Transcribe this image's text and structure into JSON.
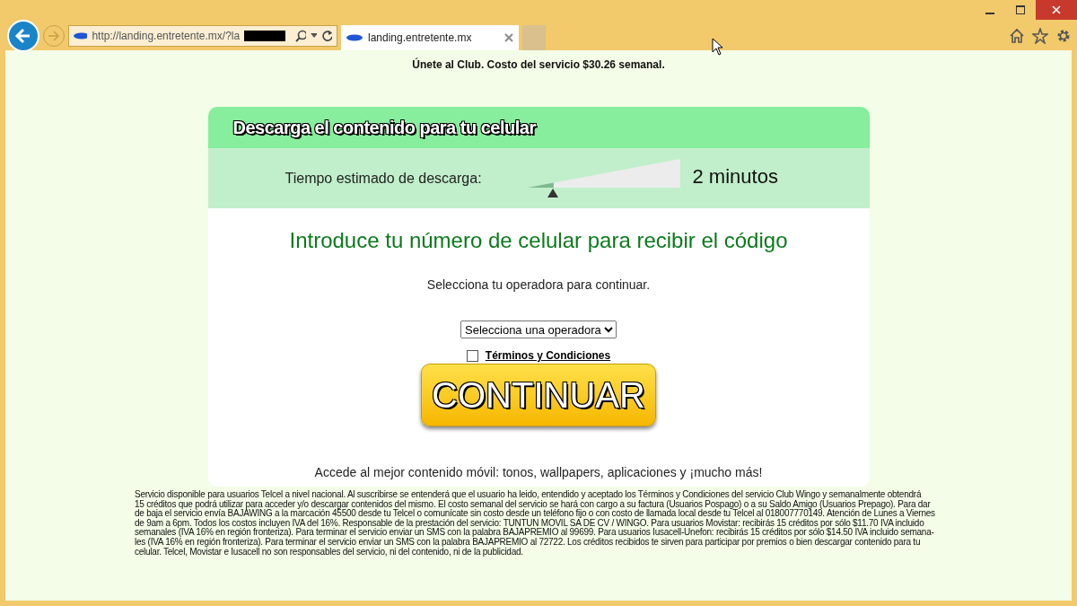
{
  "browser": {
    "address": "http://landing.entretente.mx/?la",
    "tab": {
      "title": "landing.entretente.mx",
      "selected": true
    }
  },
  "page": {
    "notice": "Únete al Club. Costo del servicio $30.26 semanal.",
    "card": {
      "title": "Descarga el contenido para tu celular",
      "estimate_label": "Tiempo estimado de descarga:",
      "estimate": {
        "level": 0.17
      },
      "estimate_value": "2 minutos",
      "heading": "Introduce tu número de celular para recibir el código",
      "instruction": "Selecciona tu operadora para continuar.",
      "operator_select": {
        "value": "Selecciona una operadora"
      },
      "terms": {
        "label": "Términos y Condiciones",
        "checked": false
      },
      "button": "CONTINUAR",
      "tagline": "Accede al mejor contenido móvil: tonos, wallpapers, aplicaciones y ¡mucho más!"
    },
    "fine_print": [
      "Servicio disponible para usuarios Telcel a nivel nacional. Al suscribirse se entenderá que el usuario ha leido, entendido y aceptado los Términos y Condiciones del servicio Club Wingo y semanalmente obtendrá",
      "15 créditos que podrá utilizar para acceder y/o descargar contenidos del mismo. El costo semanal del servicio se hará con cargo a su factura (Usuarios Pospago) o a su Saldo Amigo (Usuarios Prepago). Para dar",
      "de baja el servicio envía BAJAWING a la marcación 45500 desde tu Telcel o comunícate sin costo desde un teléfono fijo o con costo de llamada local desde tu Telcel al 018007770149. Atención de Lunes a Viernes",
      "de 9am a 6pm. Todos los costos incluyen IVA del 16%. Responsable de la prestación del servicio: TUNTUN MOVIL SA DE CV / WINGO. Para usuarios Movistar: recibirás 15 créditos por sólo $11.70 IVA incluido",
      "semanales (IVA 16% en región fronteriza). Para terminar el servicio enviar un SMS con la palabra BAJAPREMIO al 99699. Para usuarios Iusacell-Unefon: recibirás 15 créditos por sólo $14.50 IVA incluido semana-",
      "les (IVA 16% en región fronteriza). Para terminar el servicio enviar un SMS con la palabra BAJAPREMIO al 72722. Los créditos recibidos  te sirven para participar por premios o bien descargar contenido para tu",
      "celular. Telcel, Movistar e Iusacell no son responsables del servicio, ni del contenido, ni de la publicidad."
    ]
  }
}
